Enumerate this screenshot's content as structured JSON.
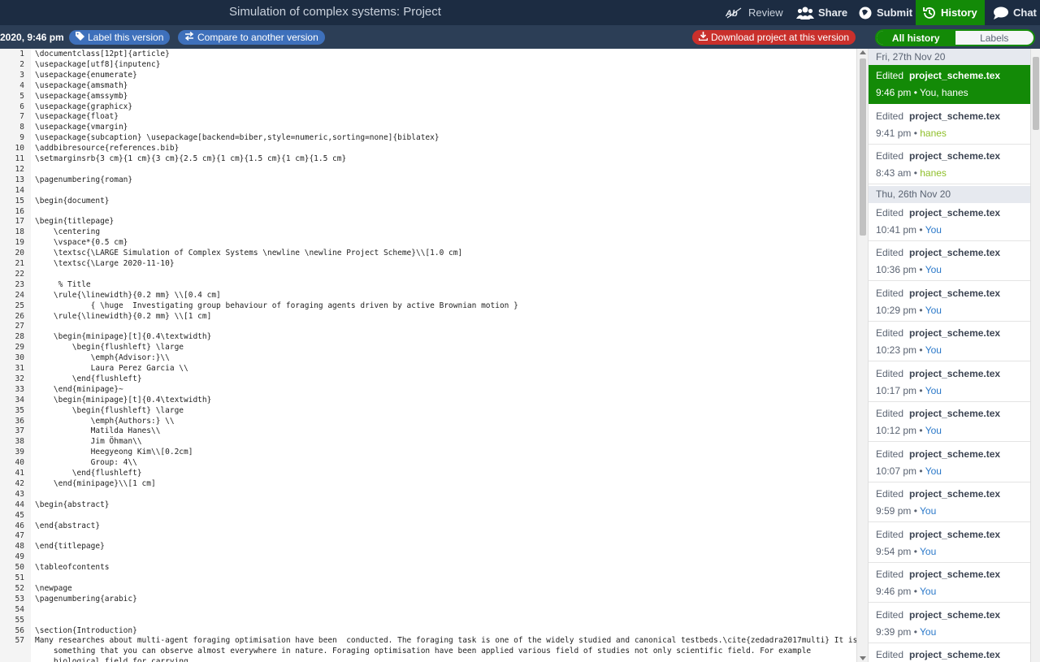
{
  "topbar": {
    "title": "Simulation of complex systems: Project",
    "review_label": "Review",
    "share_label": "Share",
    "submit_label": "Submit",
    "history_label": "History",
    "chat_label": "Chat"
  },
  "subbar": {
    "timestamp": "2020, 9:46 pm",
    "label_version": "Label this version",
    "compare_version": "Compare to another version",
    "download": "Download project at this version",
    "all_history": "All history",
    "labels": "Labels"
  },
  "editor": {
    "lines": [
      "\\documentclass[12pt]{article}",
      "\\usepackage[utf8]{inputenc}",
      "\\usepackage{enumerate}",
      "\\usepackage{amsmath}",
      "\\usepackage{amssymb}",
      "\\usepackage{graphicx}",
      "\\usepackage{float}",
      "\\usepackage{vmargin}",
      "\\usepackage{subcaption} \\usepackage[backend=biber,style=numeric,sorting=none]{biblatex}",
      "\\addbibresource{references.bib}",
      "\\setmarginsrb{3 cm}{1 cm}{3 cm}{2.5 cm}{1 cm}{1.5 cm}{1 cm}{1.5 cm}",
      "",
      "\\pagenumbering{roman}",
      "",
      "\\begin{document}",
      "",
      "\\begin{titlepage}",
      "    \\centering",
      "    \\vspace*{0.5 cm}",
      "    \\textsc{\\LARGE Simulation of Complex Systems \\newline \\newline Project Scheme}\\\\[1.0 cm]",
      "    \\textsc{\\Large 2020-11-10}",
      "",
      "     % Title",
      "    \\rule{\\linewidth}{0.2 mm} \\\\[0.4 cm]",
      "            { \\huge  Investigating group behaviour of foraging agents driven by active Brownian motion }",
      "    \\rule{\\linewidth}{0.2 mm} \\\\[1 cm]",
      "",
      "    \\begin{minipage}[t]{0.4\\textwidth}",
      "        \\begin{flushleft} \\large",
      "            \\emph{Advisor:}\\\\",
      "            Laura Perez Garcia \\\\",
      "        \\end{flushleft}",
      "    \\end{minipage}~",
      "    \\begin{minipage}[t]{0.4\\textwidth}",
      "        \\begin{flushleft} \\large",
      "            \\emph{Authors:} \\\\",
      "            Matilda Hanes\\\\",
      "            Jim Öhman\\\\",
      "            Heegyeong Kim\\\\[0.2cm]",
      "            Group: 4\\\\",
      "        \\end{flushleft}",
      "    \\end{minipage}\\\\[1 cm]",
      "",
      "\\begin{abstract}",
      "",
      "\\end{abstract}",
      "",
      "\\end{titlepage}",
      "",
      "\\tableofcontents",
      "",
      "\\newpage",
      "\\pagenumbering{arabic}",
      "",
      "",
      "\\section{Introduction}",
      "Many researches about multi-agent foraging optimisation have been  conducted. The foraging task is one of the widely studied and canonical testbeds.\\cite{zedadra2017multi} It is",
      "    something that you can observe almost everywhere in nature. Foraging optimisation have been applied various field of studies not only scientific field. For example",
      "    biological field for carrying"
    ],
    "line_numbers": [
      "1",
      "2",
      "3",
      "4",
      "5",
      "6",
      "7",
      "8",
      "9",
      "10",
      "11",
      "12",
      "13",
      "14",
      "15",
      "16",
      "17",
      "18",
      "19",
      "20",
      "21",
      "22",
      "23",
      "24",
      "25",
      "26",
      "27",
      "28",
      "29",
      "30",
      "31",
      "32",
      "33",
      "34",
      "35",
      "36",
      "37",
      "38",
      "39",
      "40",
      "41",
      "42",
      "43",
      "44",
      "45",
      "46",
      "47",
      "48",
      "49",
      "50",
      "51",
      "52",
      "53",
      "54",
      "55",
      "56",
      "57",
      "",
      ""
    ]
  },
  "history": {
    "groups": [
      {
        "day": "Fri, 27th Nov 20",
        "entries": [
          {
            "action": "Edited",
            "file": "project_scheme.tex",
            "time": "9:46 pm",
            "users": "You, hanes",
            "user_type": "you",
            "selected": true
          },
          {
            "action": "Edited",
            "file": "project_scheme.tex",
            "time": "9:41 pm",
            "users": "hanes",
            "user_type": "hanes"
          },
          {
            "action": "Edited",
            "file": "project_scheme.tex",
            "time": "8:43 am",
            "users": "hanes",
            "user_type": "hanes"
          }
        ]
      },
      {
        "day": "Thu, 26th Nov 20",
        "entries": [
          {
            "action": "Edited",
            "file": "project_scheme.tex",
            "time": "10:41 pm",
            "users": "You",
            "user_type": "you"
          },
          {
            "action": "Edited",
            "file": "project_scheme.tex",
            "time": "10:36 pm",
            "users": "You",
            "user_type": "you"
          },
          {
            "action": "Edited",
            "file": "project_scheme.tex",
            "time": "10:29 pm",
            "users": "You",
            "user_type": "you"
          },
          {
            "action": "Edited",
            "file": "project_scheme.tex",
            "time": "10:23 pm",
            "users": "You",
            "user_type": "you"
          },
          {
            "action": "Edited",
            "file": "project_scheme.tex",
            "time": "10:17 pm",
            "users": "You",
            "user_type": "you"
          },
          {
            "action": "Edited",
            "file": "project_scheme.tex",
            "time": "10:12 pm",
            "users": "You",
            "user_type": "you"
          },
          {
            "action": "Edited",
            "file": "project_scheme.tex",
            "time": "10:07 pm",
            "users": "You",
            "user_type": "you"
          },
          {
            "action": "Edited",
            "file": "project_scheme.tex",
            "time": "9:59 pm",
            "users": "You",
            "user_type": "you"
          },
          {
            "action": "Edited",
            "file": "project_scheme.tex",
            "time": "9:54 pm",
            "users": "You",
            "user_type": "you"
          },
          {
            "action": "Edited",
            "file": "project_scheme.tex",
            "time": "9:46 pm",
            "users": "You",
            "user_type": "you"
          },
          {
            "action": "Edited",
            "file": "project_scheme.tex",
            "time": "9:39 pm",
            "users": "You",
            "user_type": "you"
          },
          {
            "action": "Edited",
            "file": "project_scheme.tex",
            "time": "",
            "users": "",
            "user_type": "you"
          }
        ]
      }
    ],
    "bullet": "•"
  },
  "colors": {
    "topbar_bg": "#1c2c42",
    "subbar_bg": "#2c3e56",
    "accent_green": "#138a07",
    "pill_blue": "#3e70bb",
    "pill_red": "#c9302c",
    "user_you": "#2a78c9",
    "user_hanes": "#8fbf2a"
  },
  "icons": [
    "review-icon",
    "share-icon",
    "submit-icon",
    "history-icon",
    "chat-icon",
    "tag-icon",
    "compare-icon",
    "download-icon"
  ]
}
